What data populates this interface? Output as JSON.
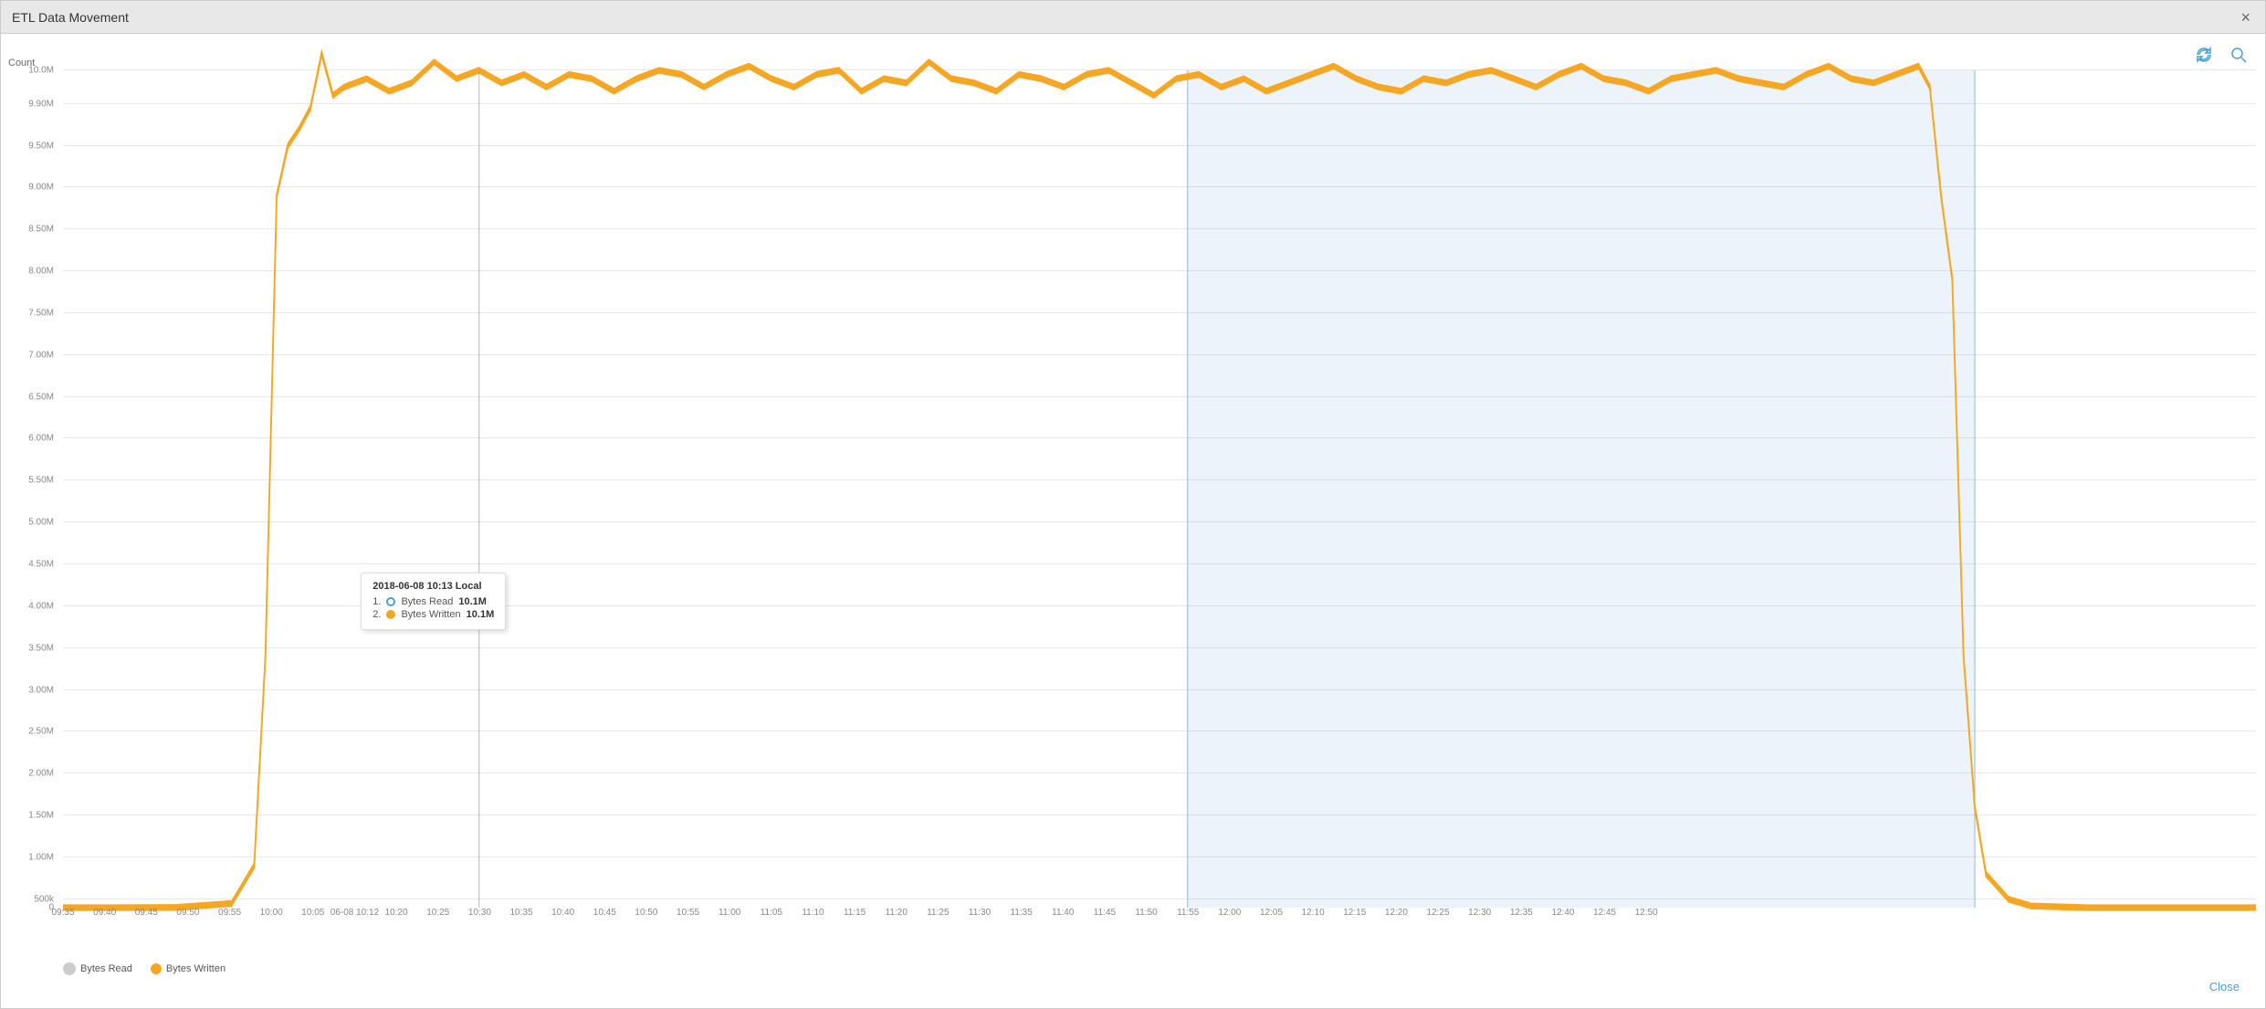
{
  "window": {
    "title": "ETL Data Movement",
    "close_label": "×"
  },
  "toolbar": {
    "refresh_icon": "↻",
    "search_icon": "🔍"
  },
  "chart": {
    "y_axis_label": "Count",
    "y_ticks": [
      {
        "label": "10.0M",
        "pct": 100
      },
      {
        "label": "9.90M",
        "pct": 96
      },
      {
        "label": "9.50M",
        "pct": 91
      },
      {
        "label": "9.00M",
        "pct": 86
      },
      {
        "label": "8.50M",
        "pct": 81
      },
      {
        "label": "8.00M",
        "pct": 76
      },
      {
        "label": "7.50M",
        "pct": 71
      },
      {
        "label": "7.00M",
        "pct": 66
      },
      {
        "label": "6.50M",
        "pct": 61
      },
      {
        "label": "6.00M",
        "pct": 56
      },
      {
        "label": "5.50M",
        "pct": 51
      },
      {
        "label": "5.00M",
        "pct": 46
      },
      {
        "label": "4.50M",
        "pct": 41
      },
      {
        "label": "4.00M",
        "pct": 36
      },
      {
        "label": "3.50M",
        "pct": 31
      },
      {
        "label": "3.00M",
        "pct": 26
      },
      {
        "label": "2.50M",
        "pct": 21
      },
      {
        "label": "2.00M",
        "pct": 16
      },
      {
        "label": "1.50M",
        "pct": 11
      },
      {
        "label": "1.00M",
        "pct": 6
      },
      {
        "label": "500k",
        "pct": 1
      },
      {
        "label": "0",
        "pct": 0
      }
    ],
    "x_ticks": [
      {
        "label": "09:35",
        "pct": 0
      },
      {
        "label": "09:40",
        "pct": 1.9
      },
      {
        "label": "09:45",
        "pct": 3.8
      },
      {
        "label": "09:50",
        "pct": 5.7
      },
      {
        "label": "09:55",
        "pct": 7.6
      },
      {
        "label": "10:00",
        "pct": 9.5
      },
      {
        "label": "10:05",
        "pct": 11.4
      },
      {
        "label": "06-08 10:12",
        "pct": 13.3
      },
      {
        "label": "10:20",
        "pct": 15.2
      },
      {
        "label": "10:25",
        "pct": 17.1
      },
      {
        "label": "10:30",
        "pct": 19
      },
      {
        "label": "10:35",
        "pct": 20.9
      },
      {
        "label": "10:40",
        "pct": 22.8
      },
      {
        "label": "10:45",
        "pct": 24.7
      },
      {
        "label": "10:50",
        "pct": 26.6
      },
      {
        "label": "10:55",
        "pct": 28.5
      },
      {
        "label": "11:00",
        "pct": 30.4
      },
      {
        "label": "11:05",
        "pct": 32.3
      },
      {
        "label": "11:10",
        "pct": 34.2
      },
      {
        "label": "11:15",
        "pct": 36.1
      },
      {
        "label": "11:20",
        "pct": 38
      },
      {
        "label": "11:25",
        "pct": 39.9
      },
      {
        "label": "11:30",
        "pct": 41.8
      },
      {
        "label": "11:35",
        "pct": 43.7
      },
      {
        "label": "11:40",
        "pct": 45.6
      },
      {
        "label": "11:45",
        "pct": 47.5
      },
      {
        "label": "11:50",
        "pct": 49.4
      },
      {
        "label": "11:55",
        "pct": 51.3
      },
      {
        "label": "12:00",
        "pct": 53.2
      },
      {
        "label": "12:05",
        "pct": 55.1
      },
      {
        "label": "12:10",
        "pct": 57
      },
      {
        "label": "12:15",
        "pct": 58.9
      },
      {
        "label": "12:20",
        "pct": 60.8
      },
      {
        "label": "12:25",
        "pct": 62.7
      },
      {
        "label": "12:30",
        "pct": 64.6
      },
      {
        "label": "12:35",
        "pct": 66.5
      },
      {
        "label": "12:40",
        "pct": 68.4
      },
      {
        "label": "12:45",
        "pct": 70.3
      },
      {
        "label": "12:50",
        "pct": 72.2
      }
    ]
  },
  "legend": {
    "bytes_read_label": "Bytes Read",
    "bytes_written_label": "Bytes Written"
  },
  "tooltip": {
    "title": "2018-06-08 10:13 Local",
    "row1_num": "1.",
    "row1_label": "Bytes Read",
    "row1_value": "10.1M",
    "row2_num": "2.",
    "row2_label": "Bytes Written",
    "row2_value": "10.1M"
  },
  "footer": {
    "close_label": "Close"
  },
  "colors": {
    "orange": "#f5a623",
    "blue_circle": "#4a9fd4",
    "grid": "#e8e8e8"
  }
}
